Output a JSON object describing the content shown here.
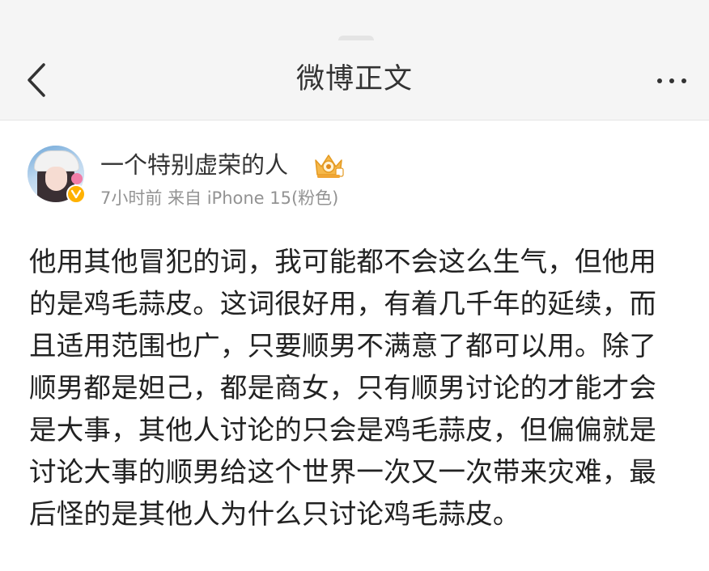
{
  "header": {
    "title": "微博正文",
    "back_icon": "chevron-left-icon",
    "more_icon": "more-horizontal-icon"
  },
  "author": {
    "name": "一个特别虚荣的人",
    "verified_icon": "verified-v-icon",
    "member_icon": "crown-vip-icon",
    "meta": "7小时前  来自 iPhone 15(粉色)"
  },
  "post": {
    "text": "他用其他冒犯的词，我可能都不会这么生气，但他用\n的是鸡毛蒜皮。这词很好用，有着几千年的延续，而\n且适用范围也广，只要顺男不满意了都可以用。除了\n顺男都是妲己，都是商女，只有顺男讨论的才能才会\n是大事，其他人讨论的只会是鸡毛蒜皮，但偏偏就是\n讨论大事的顺男给这个世界一次又一次带来灾难，最\n后怪的是其他人为什么只讨论鸡毛蒜皮。"
  },
  "colors": {
    "header_bg": "#f5f5f5",
    "text": "#222222",
    "meta": "#939393",
    "verified": "#ffb100"
  }
}
